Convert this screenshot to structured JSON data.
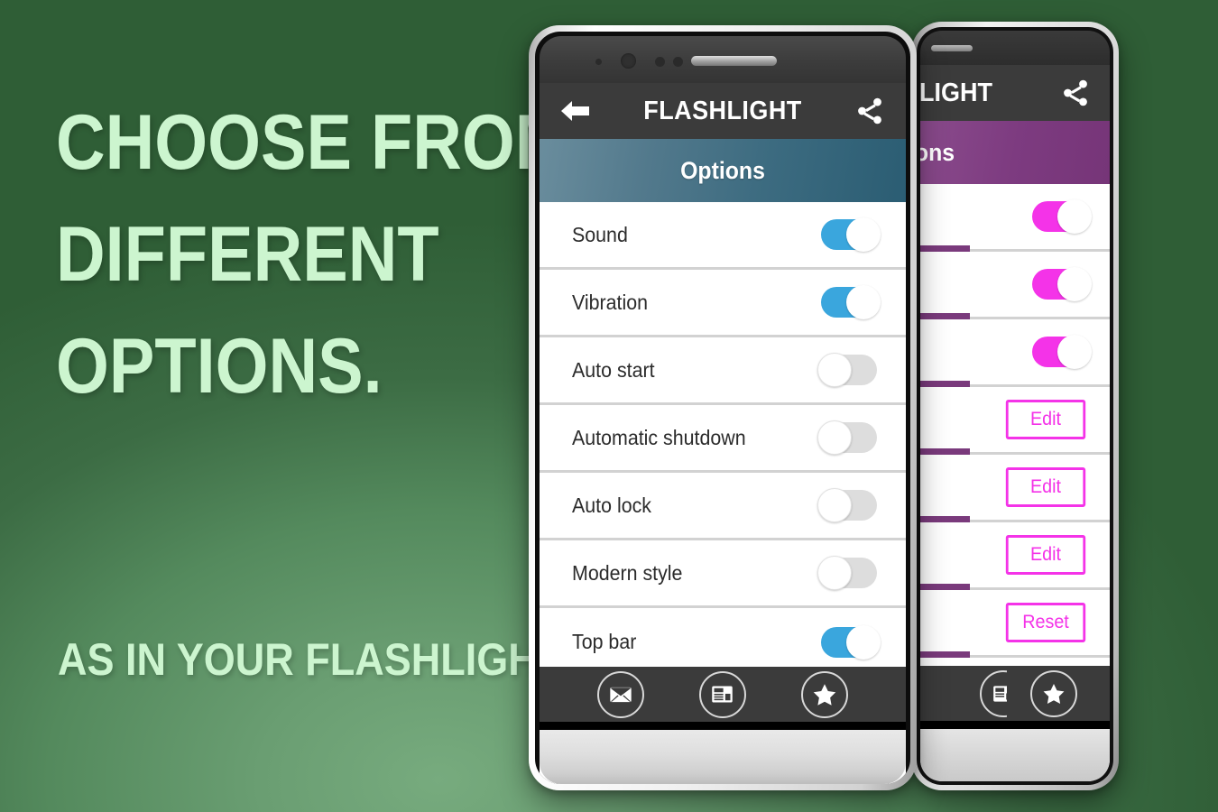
{
  "promo": {
    "lines": [
      "CHOOSE FROM",
      "DIFFERENT",
      "OPTIONS."
    ],
    "tagline": "AS IN YOUR FLASHLIGHT",
    "text_color": "#ccf5cf",
    "background_color_dark": "#2f5e36",
    "background_color_light": "#77ab7e"
  },
  "front_phone": {
    "appbar": {
      "title": "FLASHLIGHT",
      "back_icon": "back-arrow-icon",
      "share_icon": "share-icon",
      "background_color": "#3b3b3b"
    },
    "section_header": {
      "label": "Options",
      "gradient_from": "#6a8d9d",
      "gradient_to": "#2b5d73"
    },
    "accent_color": "#3aa6dd",
    "settings": [
      {
        "label": "Sound",
        "state": "on"
      },
      {
        "label": "Vibration",
        "state": "on"
      },
      {
        "label": "Auto start",
        "state": "off"
      },
      {
        "label": "Automatic shutdown",
        "state": "off"
      },
      {
        "label": "Auto lock",
        "state": "off"
      },
      {
        "label": "Modern style",
        "state": "on_partial"
      },
      {
        "label": "Top bar",
        "state": "on"
      }
    ],
    "bottom_toolbar": [
      {
        "icon": "mail-icon",
        "label": "Mail"
      },
      {
        "icon": "news-icon",
        "label": "NEWS"
      },
      {
        "icon": "star-icon",
        "label": "Rate"
      }
    ]
  },
  "back_phone": {
    "appbar": {
      "title_visible": "LIGHT",
      "share_icon": "share-icon",
      "background_color": "#3b3b3b"
    },
    "section_header": {
      "label_visible": "ons",
      "background_color": "#7d3b80"
    },
    "accent_color": "#f433e8",
    "divider_color": "#7a3a7c",
    "rows": [
      {
        "type": "toggle",
        "state": "on"
      },
      {
        "type": "toggle",
        "state": "on"
      },
      {
        "type": "toggle",
        "state": "on"
      },
      {
        "type": "button",
        "label": "Edit"
      },
      {
        "type": "button",
        "label": "Edit"
      },
      {
        "type": "button",
        "label": "Edit"
      },
      {
        "type": "button",
        "label": "Reset"
      }
    ],
    "bottom_toolbar": [
      {
        "icon": "news-icon",
        "label": "NEWS"
      },
      {
        "icon": "star-icon",
        "label": "Rate"
      }
    ]
  }
}
